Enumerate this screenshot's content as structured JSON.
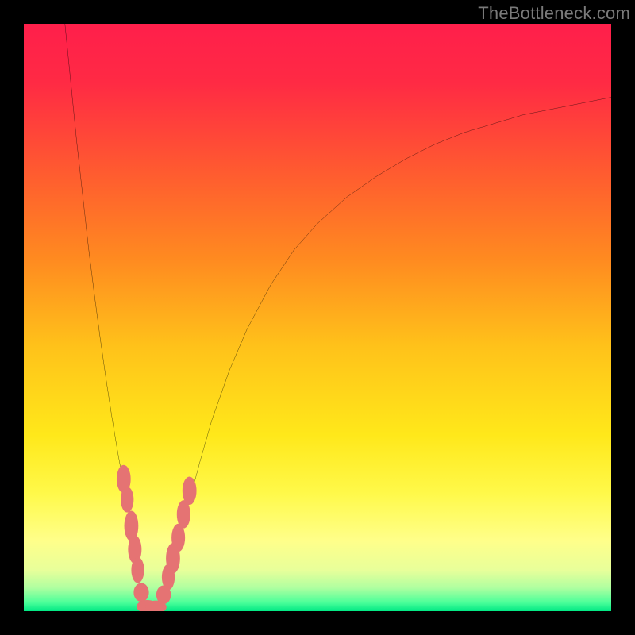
{
  "watermark": "TheBottleneck.com",
  "chart_data": {
    "type": "line",
    "title": "",
    "xlabel": "",
    "ylabel": "",
    "xlim": [
      0,
      100
    ],
    "ylim": [
      0,
      100
    ],
    "background_gradient_stops": [
      {
        "offset": 0.0,
        "color": "#ff1f4b"
      },
      {
        "offset": 0.1,
        "color": "#ff2a44"
      },
      {
        "offset": 0.25,
        "color": "#ff5a30"
      },
      {
        "offset": 0.4,
        "color": "#ff8a20"
      },
      {
        "offset": 0.55,
        "color": "#ffc21a"
      },
      {
        "offset": 0.7,
        "color": "#ffe81a"
      },
      {
        "offset": 0.8,
        "color": "#fff94a"
      },
      {
        "offset": 0.88,
        "color": "#ffff8a"
      },
      {
        "offset": 0.93,
        "color": "#e8ff9a"
      },
      {
        "offset": 0.96,
        "color": "#b0ffa0"
      },
      {
        "offset": 0.985,
        "color": "#4dff9a"
      },
      {
        "offset": 1.0,
        "color": "#00e884"
      }
    ],
    "series": [
      {
        "name": "left-branch",
        "x": [
          7.0,
          8.0,
          9.0,
          10.0,
          11.0,
          12.0,
          13.0,
          14.0,
          15.0,
          16.0,
          17.0,
          18.0,
          18.8,
          19.5,
          20.0
        ],
        "y": [
          100.0,
          90.0,
          80.0,
          71.0,
          62.0,
          54.0,
          46.5,
          39.5,
          33.0,
          27.0,
          21.5,
          16.5,
          12.0,
          7.5,
          3.0
        ]
      },
      {
        "name": "bottom-dip",
        "x": [
          20.0,
          20.5,
          21.0,
          21.5,
          22.0,
          22.5,
          23.0,
          23.5,
          24.0
        ],
        "y": [
          3.0,
          1.0,
          0.2,
          0.0,
          0.0,
          0.2,
          1.0,
          2.0,
          3.0
        ]
      },
      {
        "name": "right-branch",
        "x": [
          24.0,
          25.0,
          26.0,
          27.0,
          28.0,
          30.0,
          32.0,
          35.0,
          38.0,
          42.0,
          46.0,
          50.0,
          55.0,
          60.0,
          65.0,
          70.0,
          75.0,
          80.0,
          85.0,
          90.0,
          95.0,
          100.0
        ],
        "y": [
          3.0,
          6.0,
          10.0,
          14.0,
          18.0,
          25.5,
          32.5,
          41.0,
          48.0,
          55.5,
          61.5,
          66.0,
          70.5,
          74.0,
          77.0,
          79.5,
          81.5,
          83.0,
          84.5,
          85.5,
          86.5,
          87.5
        ]
      }
    ],
    "markers": [
      {
        "x": 17.0,
        "y": 22.5,
        "rx": 1.2,
        "ry": 2.4
      },
      {
        "x": 17.6,
        "y": 19.0,
        "rx": 1.1,
        "ry": 2.2
      },
      {
        "x": 18.3,
        "y": 14.5,
        "rx": 1.2,
        "ry": 2.6
      },
      {
        "x": 18.9,
        "y": 10.5,
        "rx": 1.15,
        "ry": 2.4
      },
      {
        "x": 19.4,
        "y": 7.0,
        "rx": 1.1,
        "ry": 2.2
      },
      {
        "x": 20.0,
        "y": 3.2,
        "rx": 1.3,
        "ry": 1.6
      },
      {
        "x": 21.0,
        "y": 0.8,
        "rx": 1.8,
        "ry": 1.1
      },
      {
        "x": 22.5,
        "y": 0.7,
        "rx": 1.8,
        "ry": 1.1
      },
      {
        "x": 23.8,
        "y": 2.8,
        "rx": 1.25,
        "ry": 1.6
      },
      {
        "x": 24.6,
        "y": 5.8,
        "rx": 1.1,
        "ry": 2.2
      },
      {
        "x": 25.4,
        "y": 9.0,
        "rx": 1.2,
        "ry": 2.6
      },
      {
        "x": 26.3,
        "y": 12.5,
        "rx": 1.15,
        "ry": 2.4
      },
      {
        "x": 27.2,
        "y": 16.5,
        "rx": 1.15,
        "ry": 2.4
      },
      {
        "x": 28.2,
        "y": 20.5,
        "rx": 1.2,
        "ry": 2.4
      }
    ],
    "marker_color": "#e57373",
    "curve_color": "#000000",
    "curve_width": 2.3
  }
}
